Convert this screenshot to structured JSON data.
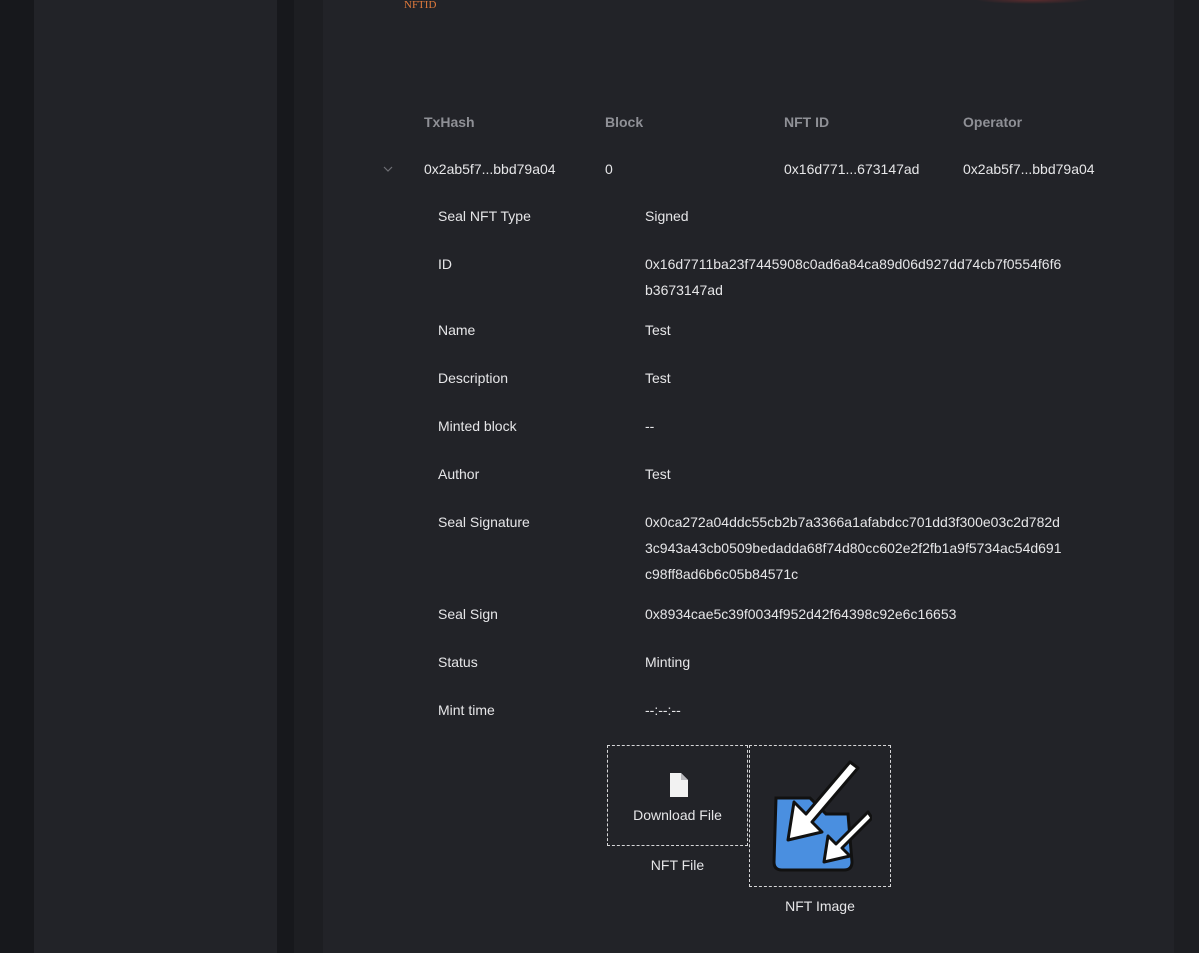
{
  "top_label": "NFTID",
  "table": {
    "headers": {
      "txhash": "TxHash",
      "block": "Block",
      "nft_id": "NFT ID",
      "operator": "Operator"
    },
    "row": {
      "txhash": "0x2ab5f7...bbd79a04",
      "block": "0",
      "nft_id": "0x16d771...673147ad",
      "operator": "0x2ab5f7...bbd79a04"
    }
  },
  "details": [
    {
      "label": "Seal NFT Type",
      "value": "Signed"
    },
    {
      "label": "ID",
      "value": "0x16d7711ba23f7445908c0ad6a84ca89d06d927dd74cb7f0554f6f6b3673147ad"
    },
    {
      "label": "Name",
      "value": "Test"
    },
    {
      "label": "Description",
      "value": "Test"
    },
    {
      "label": "Minted block",
      "value": "--"
    },
    {
      "label": "Author",
      "value": "Test"
    },
    {
      "label": "Seal Signature",
      "value": "0x0ca272a04ddc55cb2b7a3366a1afabdcc701dd3f300e03c2d782d3c943a43cb0509bedadda68f74d80cc602e2f2fb1a9f5734ac54d691c98ff8ad6b6c05b84571c"
    },
    {
      "label": "Seal Sign",
      "value": "0x8934cae5c39f0034f952d42f64398c92e6c16653"
    },
    {
      "label": "Status",
      "value": "Minting"
    },
    {
      "label": "Mint time",
      "value": "--:--:--"
    }
  ],
  "file": {
    "button_label": "Download File",
    "caption": "NFT File",
    "icon": "file-icon"
  },
  "image": {
    "caption": "NFT Image",
    "icon": "nft-image"
  },
  "colors": {
    "background": "#17181c",
    "panel": "#222328",
    "accent": "#e07a3c",
    "header_text": "#8f9096",
    "text": "#e6e6e8",
    "image_blue": "#4a8fe0"
  }
}
